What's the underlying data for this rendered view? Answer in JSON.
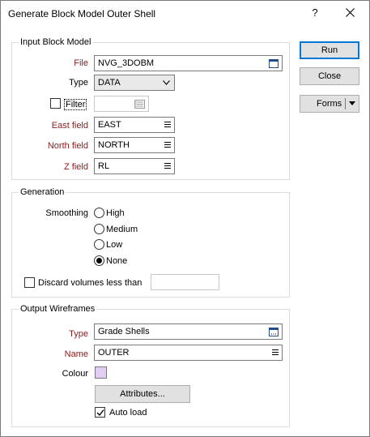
{
  "window": {
    "title": "Generate Block Model Outer Shell",
    "help_label": "?"
  },
  "buttons": {
    "run": "Run",
    "close": "Close",
    "forms": "Forms"
  },
  "input_block_model": {
    "title": "Input Block Model",
    "file_label": "File",
    "file_value": "NVG_3DOBM",
    "type_label": "Type",
    "type_value": "DATA",
    "filter_label": "Filter",
    "filter_checked": false,
    "filter_value": "",
    "east_label": "East field",
    "east_value": "EAST",
    "north_label": "North field",
    "north_value": "NORTH",
    "z_label": "Z field",
    "z_value": "RL"
  },
  "generation": {
    "title": "Generation",
    "smoothing_label": "Smoothing",
    "options": [
      "High",
      "Medium",
      "Low",
      "None"
    ],
    "selected": "None",
    "discard_label": "Discard volumes less than",
    "discard_checked": false,
    "discard_value": ""
  },
  "output_wireframes": {
    "title": "Output Wireframes",
    "type_label": "Type",
    "type_value": "Grade Shells",
    "name_label": "Name",
    "name_value": "OUTER",
    "colour_label": "Colour",
    "colour_value": "#e2cdf5",
    "attributes_label": "Attributes...",
    "autoload_label": "Auto load",
    "autoload_checked": true
  }
}
